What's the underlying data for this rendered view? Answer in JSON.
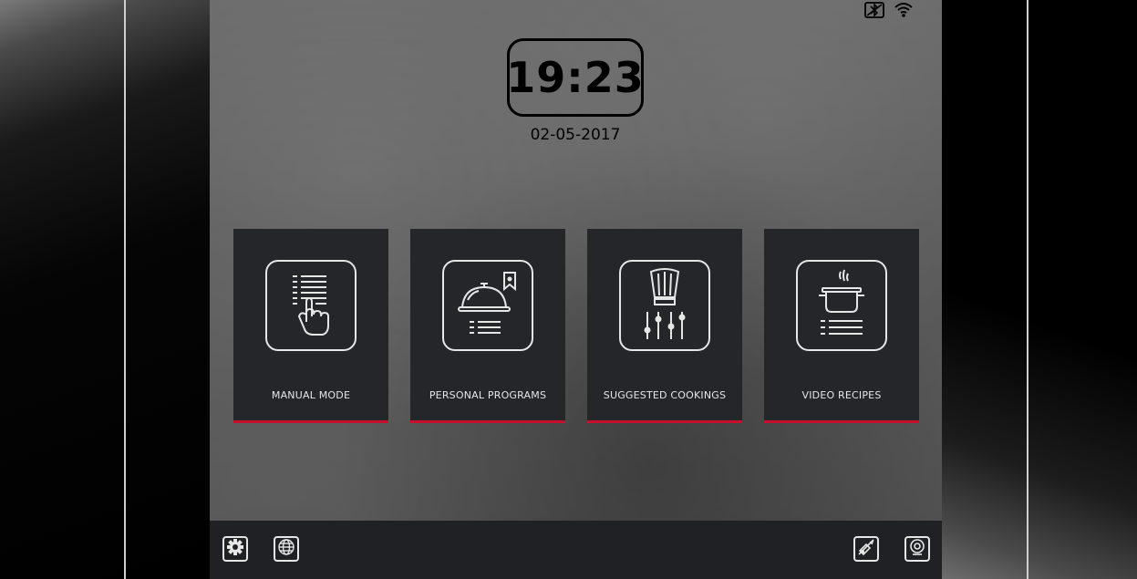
{
  "clock": {
    "time": "19:23",
    "date": "02-05-2017"
  },
  "status_icons": [
    "bluetooth-off-icon",
    "wifi-icon"
  ],
  "tiles": [
    {
      "label": "MANUAL MODE",
      "icon": "manual-mode-icon"
    },
    {
      "label": "PERSONAL PROGRAMS",
      "icon": "cloche-bookmark-icon"
    },
    {
      "label": "SUGGESTED COOKINGS",
      "icon": "chef-hat-sliders-icon"
    },
    {
      "label": "VIDEO RECIPES",
      "icon": "steaming-pot-icon"
    }
  ],
  "bottom_bar": {
    "left": [
      "settings-gear-icon",
      "language-globe-icon"
    ],
    "right": [
      "camera-off-icon",
      "webcam-icon"
    ]
  },
  "colors": {
    "accent": "#c8102e",
    "tile": "#24262a",
    "bar": "#1f2124"
  }
}
